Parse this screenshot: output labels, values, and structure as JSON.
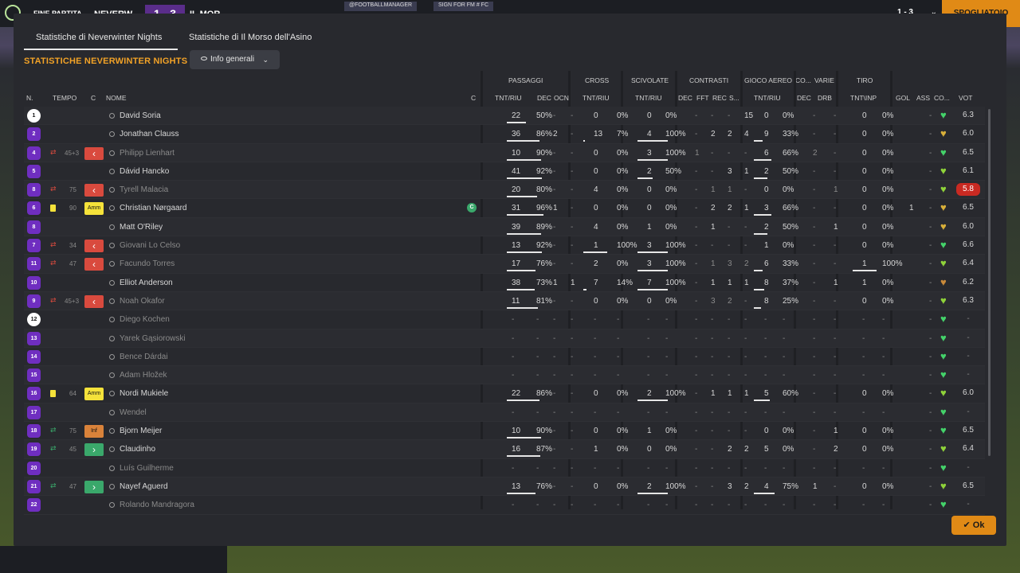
{
  "topbar": {
    "label": "FINE PARTITA",
    "home": "NEVERW",
    "score": "1 - 3",
    "away": "IL MOR",
    "ad1": "@FOOTBALLMANAGER",
    "ad2": "SIGN FOR FM # FC",
    "right_score": "1 - 3",
    "right_button": "SPOGLIATOIO"
  },
  "tabs": [
    {
      "label": "Statistiche di Neverwinter Nights"
    },
    {
      "label": "Statistiche di Il Morso dell'Asino"
    }
  ],
  "section_title": "STATISTICHE NEVERWINTER NIGHTS",
  "view_button": "Info generali",
  "group_headers": [
    "PASSAGGI",
    "CROSS",
    "SCIVOLATE",
    "CONTRASTI",
    "GIOCO AEREO",
    "CO...",
    "VARIE",
    "TIRO"
  ],
  "headers": [
    "N.",
    "TEMPO",
    "C",
    "NOME",
    "C",
    "TNT/RIU",
    "DEC",
    "OCN",
    "TNT/RIU",
    "TNT/RIU",
    "DEC",
    "FFT",
    "REC",
    "S...",
    "TNT/RIU",
    "DEC",
    "DRB",
    "TNT\\INP",
    "GOL",
    "ASS",
    "CO...",
    "VOT"
  ],
  "ok_label": "Ok",
  "players": [
    {
      "n": "1",
      "gk": true,
      "name": "David Soria",
      "p": "22",
      "pp": "50%",
      "pd": "-",
      "po": "-",
      "c": "0",
      "cp": "0%",
      "s": "0",
      "sp": "0%",
      "cd": "-",
      "cf": "-",
      "cr": "-",
      "cs": "15",
      "a": "0",
      "ap": "0%",
      "cod": "-",
      "vd": "-",
      "t": "0",
      "tp": "0%",
      "g": "",
      "as": "-",
      "heart": "#44d36a",
      "vot": "6.3"
    },
    {
      "n": "2",
      "name": "Jonathan Clauss",
      "p": "36",
      "pp": "86%",
      "pd": "2",
      "po": "-",
      "c": "13",
      "cp": "7%",
      "s": "4",
      "sp": "100%",
      "cd": "-",
      "cf": "2",
      "cr": "2",
      "cs": "4",
      "a": "9",
      "ap": "33%",
      "cod": "-",
      "vd": "-",
      "t": "0",
      "tp": "0%",
      "g": "",
      "as": "-",
      "heart": "#d9b03a",
      "vot": "6.0"
    },
    {
      "n": "4",
      "dim": true,
      "swap": true,
      "tempo": "45+3",
      "out": true,
      "name": "Philipp Lienhart",
      "p": "10",
      "pp": "90%",
      "pd": "-",
      "po": "-",
      "c": "0",
      "cp": "0%",
      "s": "3",
      "sp": "100%",
      "cd": "1",
      "cf": "-",
      "cr": "-",
      "cs": "-",
      "a": "6",
      "ap": "66%",
      "cod": "2",
      "vd": "-",
      "t": "0",
      "tp": "0%",
      "g": "",
      "as": "-",
      "heart": "#44d36a",
      "vot": "6.5"
    },
    {
      "n": "5",
      "name": "Dávid Hancko",
      "p": "41",
      "pp": "92%",
      "pd": "-",
      "po": "-",
      "c": "0",
      "cp": "0%",
      "s": "2",
      "sp": "50%",
      "cd": "-",
      "cf": "-",
      "cr": "3",
      "cs": "1",
      "a": "2",
      "ap": "50%",
      "cod": "-",
      "vd": "-",
      "t": "0",
      "tp": "0%",
      "g": "",
      "as": "-",
      "heart": "#8fd33a",
      "vot": "6.1"
    },
    {
      "n": "8",
      "dim": true,
      "swap": true,
      "tempo": "75",
      "out": true,
      "name": "Tyrell Malacia",
      "p": "20",
      "pp": "80%",
      "pd": "-",
      "po": "-",
      "c": "4",
      "cp": "0%",
      "s": "0",
      "sp": "0%",
      "cd": "-",
      "cf": "1",
      "cr": "1",
      "cs": "-",
      "a": "0",
      "ap": "0%",
      "cod": "-",
      "vd": "1",
      "t": "0",
      "tp": "0%",
      "g": "",
      "as": "-",
      "heart": "#8fd33a",
      "vot": "5.8",
      "bad": true
    },
    {
      "n": "6",
      "card": true,
      "tempo": "90",
      "role": "Amm",
      "rolecol": "#f5e23a",
      "name": "Christian Nørgaard",
      "captain": "C",
      "p": "31",
      "pp": "96%",
      "pd": "1",
      "po": "-",
      "c": "0",
      "cp": "0%",
      "s": "0",
      "sp": "0%",
      "cd": "-",
      "cf": "2",
      "cr": "2",
      "cs": "1",
      "a": "3",
      "ap": "66%",
      "cod": "-",
      "vd": "-",
      "t": "0",
      "tp": "0%",
      "g": "1",
      "as": "-",
      "heart": "#d9b03a",
      "vot": "6.5"
    },
    {
      "n": "8",
      "name": "Matt O'Riley",
      "p": "39",
      "pp": "89%",
      "pd": "-",
      "po": "-",
      "c": "4",
      "cp": "0%",
      "s": "1",
      "sp": "0%",
      "cd": "-",
      "cf": "1",
      "cr": "-",
      "cs": "-",
      "a": "2",
      "ap": "50%",
      "cod": "-",
      "vd": "1",
      "t": "0",
      "tp": "0%",
      "g": "",
      "as": "-",
      "heart": "#d9b03a",
      "vot": "6.0"
    },
    {
      "n": "7",
      "dim": true,
      "swap": true,
      "tempo": "34",
      "out": true,
      "name": "Giovani Lo Celso",
      "p": "13",
      "pp": "92%",
      "pd": "-",
      "po": "-",
      "c": "1",
      "cp": "100%",
      "s": "3",
      "sp": "100%",
      "cd": "-",
      "cf": "-",
      "cr": "-",
      "cs": "-",
      "a": "1",
      "ap": "0%",
      "cod": "-",
      "vd": "-",
      "t": "0",
      "tp": "0%",
      "g": "",
      "as": "-",
      "heart": "#44d36a",
      "vot": "6.6"
    },
    {
      "n": "11",
      "dim": true,
      "swap": true,
      "tempo": "47",
      "out": true,
      "name": "Facundo Torres",
      "p": "17",
      "pp": "76%",
      "pd": "-",
      "po": "-",
      "c": "2",
      "cp": "0%",
      "s": "3",
      "sp": "100%",
      "cd": "-",
      "cf": "1",
      "cr": "3",
      "cs": "2",
      "a": "6",
      "ap": "33%",
      "cod": "-",
      "vd": "-",
      "t": "1",
      "tp": "100%",
      "g": "",
      "as": "-",
      "heart": "#8fd33a",
      "vot": "6.4"
    },
    {
      "n": "10",
      "name": "Elliot Anderson",
      "p": "38",
      "pp": "73%",
      "pd": "1",
      "po": "1",
      "c": "7",
      "cp": "14%",
      "s": "7",
      "sp": "100%",
      "cd": "-",
      "cf": "1",
      "cr": "1",
      "cs": "1",
      "a": "8",
      "ap": "37%",
      "cod": "-",
      "vd": "1",
      "t": "1",
      "tp": "0%",
      "g": "",
      "as": "-",
      "heart": "#c98a3a",
      "vot": "6.2"
    },
    {
      "n": "9",
      "dim": true,
      "swap": true,
      "tempo": "45+3",
      "out": true,
      "name": "Noah Okafor",
      "p": "11",
      "pp": "81%",
      "pd": "-",
      "po": "-",
      "c": "0",
      "cp": "0%",
      "s": "0",
      "sp": "0%",
      "cd": "-",
      "cf": "3",
      "cr": "2",
      "cs": "-",
      "a": "8",
      "ap": "25%",
      "cod": "-",
      "vd": "-",
      "t": "0",
      "tp": "0%",
      "g": "",
      "as": "-",
      "heart": "#8fd33a",
      "vot": "6.3"
    },
    {
      "n": "12",
      "gk": true,
      "dim": true,
      "name": "Diego Kochen",
      "empty": true,
      "heart": "#44d36a",
      "vot": "-"
    },
    {
      "n": "13",
      "dim": true,
      "name": "Yarek Gąsiorowski",
      "empty": true,
      "heart": "#44d36a",
      "vot": "-"
    },
    {
      "n": "14",
      "dim": true,
      "name": "Bence Dárdai",
      "empty": true,
      "heart": "#44d36a",
      "vot": "-"
    },
    {
      "n": "15",
      "dim": true,
      "name": "Adam Hložek",
      "empty": true,
      "heart": "#44d36a",
      "vot": "-"
    },
    {
      "n": "16",
      "card": true,
      "tempo": "64",
      "role": "Amm",
      "rolecol": "#f5e23a",
      "name": "Nordi Mukiele",
      "p": "22",
      "pp": "86%",
      "pd": "-",
      "po": "-",
      "c": "0",
      "cp": "0%",
      "s": "2",
      "sp": "100%",
      "cd": "-",
      "cf": "1",
      "cr": "1",
      "cs": "1",
      "a": "5",
      "ap": "60%",
      "cod": "-",
      "vd": "-",
      "t": "0",
      "tp": "0%",
      "g": "",
      "as": "-",
      "heart": "#8fd33a",
      "vot": "6.0"
    },
    {
      "n": "17",
      "dim": true,
      "name": "Wendel",
      "empty": true,
      "heart": "#44d36a",
      "vot": "-"
    },
    {
      "n": "18",
      "swapin": true,
      "tempo": "75",
      "role": "Inf",
      "rolecol": "#d9823a",
      "name": "Bjorn Meijer",
      "p": "10",
      "pp": "90%",
      "pd": "-",
      "po": "-",
      "c": "0",
      "cp": "0%",
      "s": "1",
      "sp": "0%",
      "cd": "-",
      "cf": "-",
      "cr": "-",
      "cs": "-",
      "a": "0",
      "ap": "0%",
      "cod": "-",
      "vd": "1",
      "t": "0",
      "tp": "0%",
      "g": "",
      "as": "-",
      "heart": "#44d36a",
      "vot": "6.5"
    },
    {
      "n": "19",
      "swapin": true,
      "tempo": "45",
      "in": true,
      "name": "Claudinho",
      "p": "16",
      "pp": "87%",
      "pd": "-",
      "po": "-",
      "c": "1",
      "cp": "0%",
      "s": "0",
      "sp": "0%",
      "cd": "-",
      "cf": "-",
      "cr": "2",
      "cs": "2",
      "a": "5",
      "ap": "0%",
      "cod": "-",
      "vd": "2",
      "t": "0",
      "tp": "0%",
      "g": "",
      "as": "-",
      "heart": "#8fd33a",
      "vot": "6.4"
    },
    {
      "n": "20",
      "dim": true,
      "name": "Luís Guilherme",
      "empty": true,
      "heart": "#44d36a",
      "vot": "-"
    },
    {
      "n": "21",
      "swapin": true,
      "tempo": "47",
      "in": true,
      "name": "Nayef Aguerd",
      "p": "13",
      "pp": "76%",
      "pd": "-",
      "po": "-",
      "c": "0",
      "cp": "0%",
      "s": "2",
      "sp": "100%",
      "cd": "-",
      "cf": "-",
      "cr": "3",
      "cs": "2",
      "a": "4",
      "ap": "75%",
      "cod": "1",
      "vd": "-",
      "t": "0",
      "tp": "0%",
      "g": "",
      "as": "-",
      "heart": "#8fd33a",
      "vot": "6.5"
    },
    {
      "n": "22",
      "dim": true,
      "name": "Rolando Mandragora",
      "empty": true,
      "heart": "#44d36a",
      "vot": "-"
    }
  ]
}
